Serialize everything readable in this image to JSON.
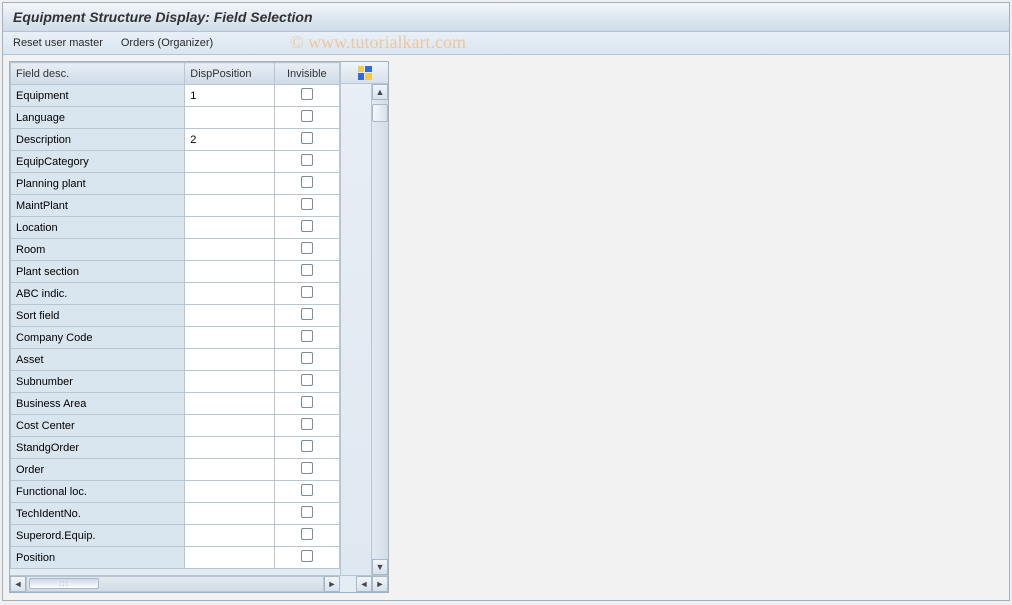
{
  "title": "Equipment Structure Display: Field Selection",
  "menu": {
    "reset": "Reset user master",
    "orders": "Orders (Organizer)"
  },
  "watermark": "© www.tutorialkart.com",
  "table": {
    "headers": {
      "desc": "Field desc.",
      "disp": "DispPosition",
      "inv": "Invisible"
    },
    "rows": [
      {
        "desc": "Equipment",
        "disp": "1",
        "inv": false
      },
      {
        "desc": "Language",
        "disp": "",
        "inv": false
      },
      {
        "desc": "Description",
        "disp": "2",
        "inv": false
      },
      {
        "desc": "EquipCategory",
        "disp": "",
        "inv": false
      },
      {
        "desc": "Planning plant",
        "disp": "",
        "inv": false
      },
      {
        "desc": "MaintPlant",
        "disp": "",
        "inv": false
      },
      {
        "desc": "Location",
        "disp": "",
        "inv": false
      },
      {
        "desc": "Room",
        "disp": "",
        "inv": false
      },
      {
        "desc": "Plant section",
        "disp": "",
        "inv": false
      },
      {
        "desc": "ABC indic.",
        "disp": "",
        "inv": false
      },
      {
        "desc": "Sort field",
        "disp": "",
        "inv": false
      },
      {
        "desc": "Company Code",
        "disp": "",
        "inv": false
      },
      {
        "desc": "Asset",
        "disp": "",
        "inv": false
      },
      {
        "desc": "Subnumber",
        "disp": "",
        "inv": false
      },
      {
        "desc": "Business Area",
        "disp": "",
        "inv": false
      },
      {
        "desc": "Cost Center",
        "disp": "",
        "inv": false
      },
      {
        "desc": "StandgOrder",
        "disp": "",
        "inv": false
      },
      {
        "desc": "Order",
        "disp": "",
        "inv": false
      },
      {
        "desc": "Functional loc.",
        "disp": "",
        "inv": false
      },
      {
        "desc": "TechIdentNo.",
        "disp": "",
        "inv": false
      },
      {
        "desc": "Superord.Equip.",
        "disp": "",
        "inv": false
      },
      {
        "desc": "Position",
        "disp": "",
        "inv": false
      }
    ]
  },
  "icons": {
    "config": "column-config-icon",
    "up": "▲",
    "down": "▼",
    "left": "◄",
    "right": "►",
    "thumb": ":::"
  }
}
